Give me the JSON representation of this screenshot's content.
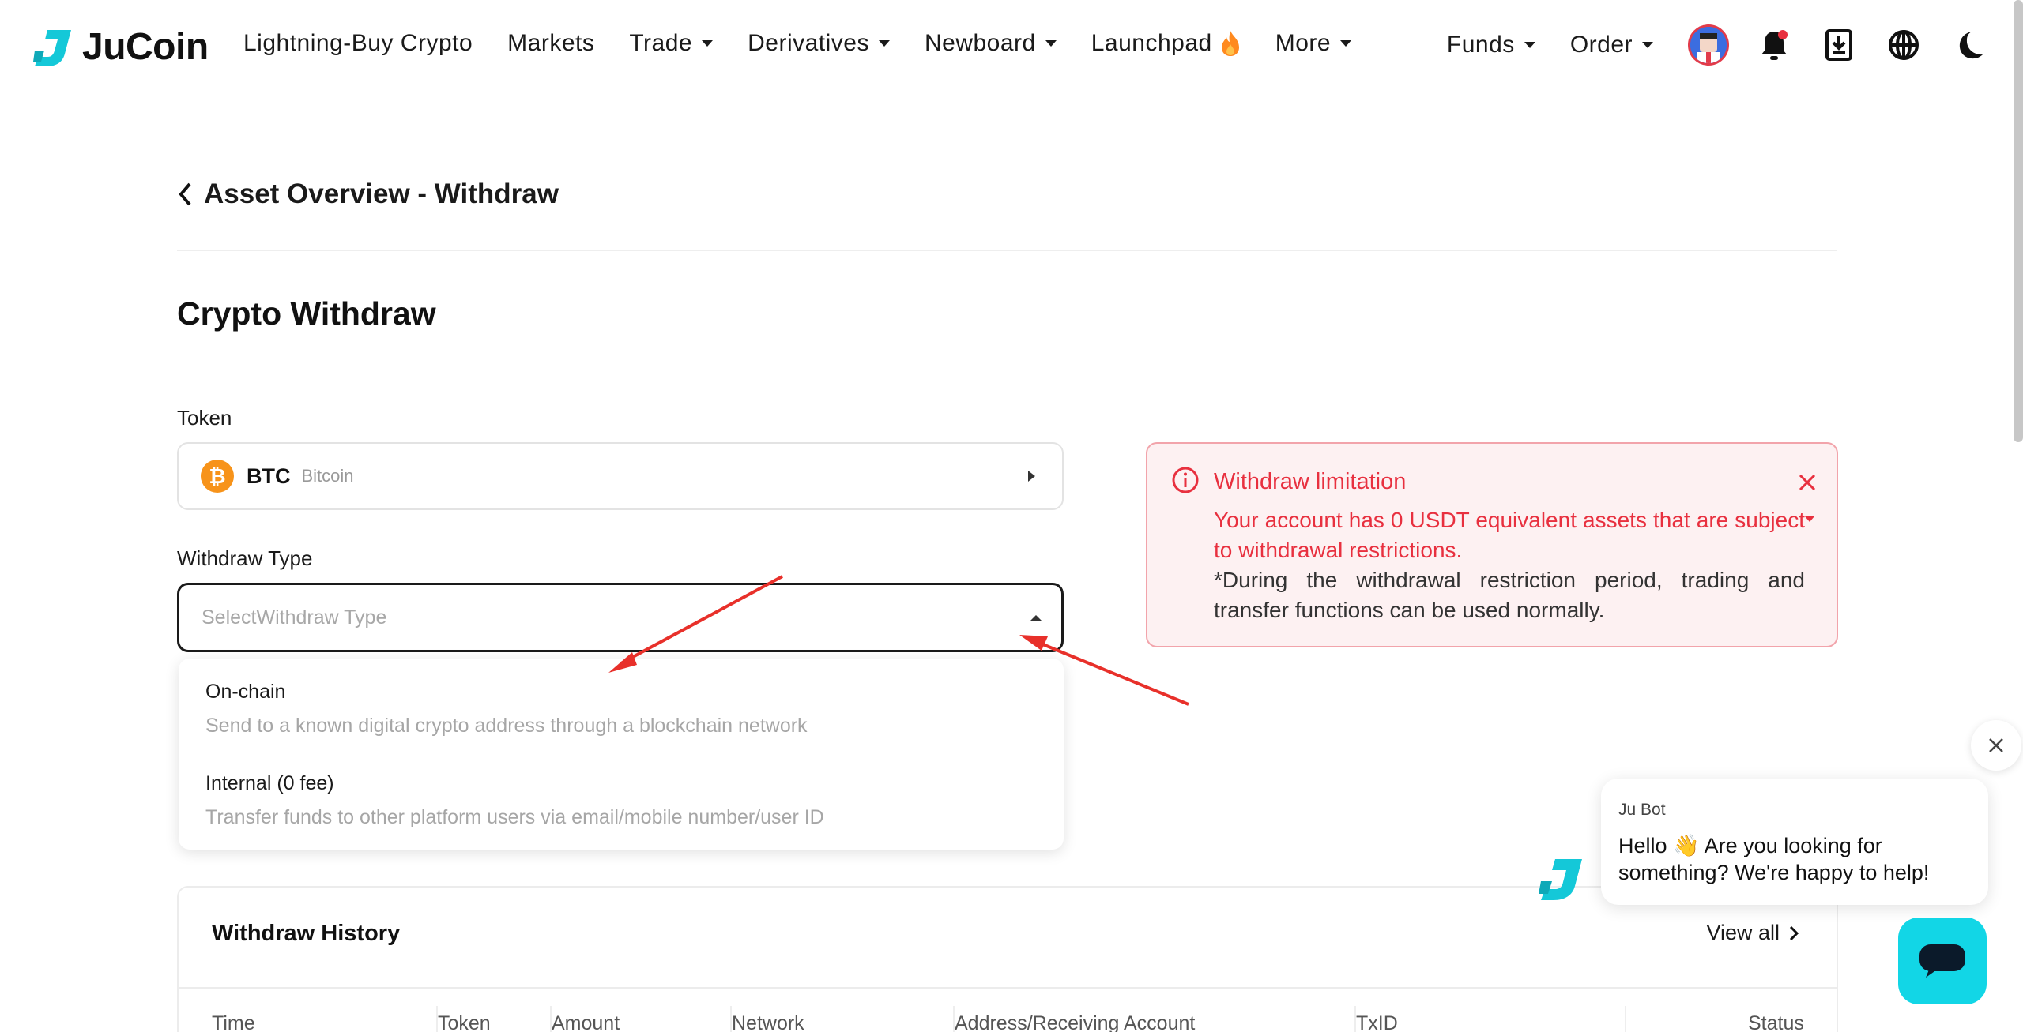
{
  "brand": {
    "name": "JuCoin",
    "accent": "#14c8d8"
  },
  "nav": {
    "items": [
      {
        "label": "Lightning-Buy Crypto"
      },
      {
        "label": "Markets"
      },
      {
        "label": "Trade"
      },
      {
        "label": "Derivatives"
      },
      {
        "label": "Newboard"
      },
      {
        "label": "Launchpad"
      },
      {
        "label": "More"
      }
    ],
    "right": {
      "funds": "Funds",
      "order": "Order"
    },
    "icons": [
      "user-avatar",
      "bell-icon",
      "download-icon",
      "globe-icon",
      "moon-icon"
    ]
  },
  "page": {
    "breadcrumb": "Asset Overview - Withdraw",
    "title": "Crypto Withdraw"
  },
  "form": {
    "token_label": "Token",
    "token": {
      "symbol": "BTC",
      "name": "Bitcoin"
    },
    "type_label": "Withdraw Type",
    "type_placeholder": "SelectWithdraw Type",
    "options": [
      {
        "title": "On-chain",
        "desc": "Send to a known digital crypto address through a blockchain network"
      },
      {
        "title": "Internal (0 fee)",
        "desc": "Transfer funds to other platform users via email/mobile number/user ID"
      }
    ]
  },
  "alert": {
    "title": "Withdraw limitation",
    "body": "Your account has 0 USDT equivalent assets that are subject to withdrawal restrictions.",
    "note": "*During the withdrawal restriction period, trading and transfer functions can be used normally.",
    "color": "#e8303f"
  },
  "history": {
    "title": "Withdraw History",
    "view_all": "View all",
    "columns": [
      "Time",
      "Token",
      "Amount",
      "Network",
      "Address/Receiving Account",
      "TxID",
      "Status"
    ]
  },
  "chat": {
    "bot_name": "Ju Bot",
    "message": "Hello 👋 Are you looking for something? We're happy to help!"
  }
}
